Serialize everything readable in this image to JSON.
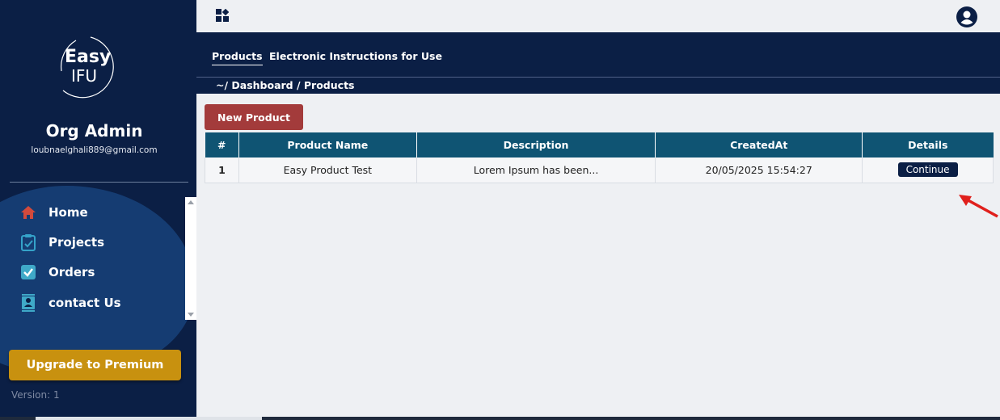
{
  "brand": {
    "logo_word_1": "Easy",
    "logo_word_2": "IFU"
  },
  "user": {
    "org_name": "Org Admin",
    "email": "loubnaelghali889@gmail.com"
  },
  "sidebar": {
    "items": [
      {
        "label": "Home",
        "icon": "home-icon",
        "color": "#d24a3c"
      },
      {
        "label": "Projects",
        "icon": "clipboard-check-icon",
        "color": "#35a3c9"
      },
      {
        "label": "Orders",
        "icon": "checkbox-icon",
        "color": "#3fa9c8"
      },
      {
        "label": "contact Us",
        "icon": "contact-card-icon",
        "color": "#3fa9c8"
      }
    ],
    "premium_label": "Upgrade to Premium",
    "version": "Version: 1"
  },
  "tabs": [
    {
      "label": "Products",
      "active": true
    },
    {
      "label": "Electronic Instructions for Use",
      "active": false
    }
  ],
  "breadcrumb": "~/ Dashboard / Products",
  "main": {
    "new_button": "New Product",
    "table": {
      "headers": [
        "#",
        "Product Name",
        "Description",
        "CreatedAt",
        "Details"
      ],
      "rows": [
        {
          "index": "1",
          "name": "Easy Product Test",
          "description": "Lorem Ipsum has been...",
          "created": "20/05/2025 15:54:27",
          "action": "Continue"
        }
      ]
    }
  },
  "colors": {
    "navy": "#0b1f45",
    "table_header": "#0f5473",
    "danger": "#a33b3b",
    "premium": "#c8910f",
    "annotation_arrow": "#e0201c"
  }
}
